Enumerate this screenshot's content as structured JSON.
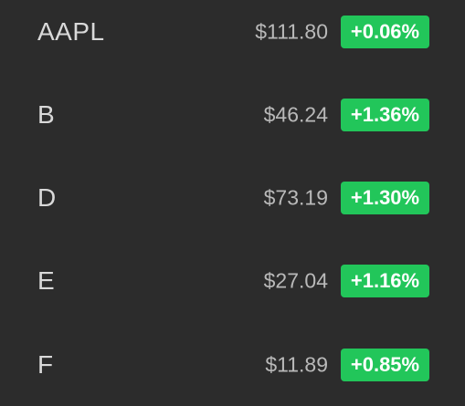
{
  "colors": {
    "background": "#2c2c2c",
    "symbol_text": "#d9d9d9",
    "price_text": "#b9b9b9",
    "positive_badge": "#22c65a",
    "badge_text": "#ffffff"
  },
  "stocks": [
    {
      "symbol": "AAPL",
      "price": "$111.80",
      "change": "+0.06%"
    },
    {
      "symbol": "B",
      "price": "$46.24",
      "change": "+1.36%"
    },
    {
      "symbol": "D",
      "price": "$73.19",
      "change": "+1.30%"
    },
    {
      "symbol": "E",
      "price": "$27.04",
      "change": "+1.16%"
    },
    {
      "symbol": "F",
      "price": "$11.89",
      "change": "+0.85%"
    }
  ]
}
